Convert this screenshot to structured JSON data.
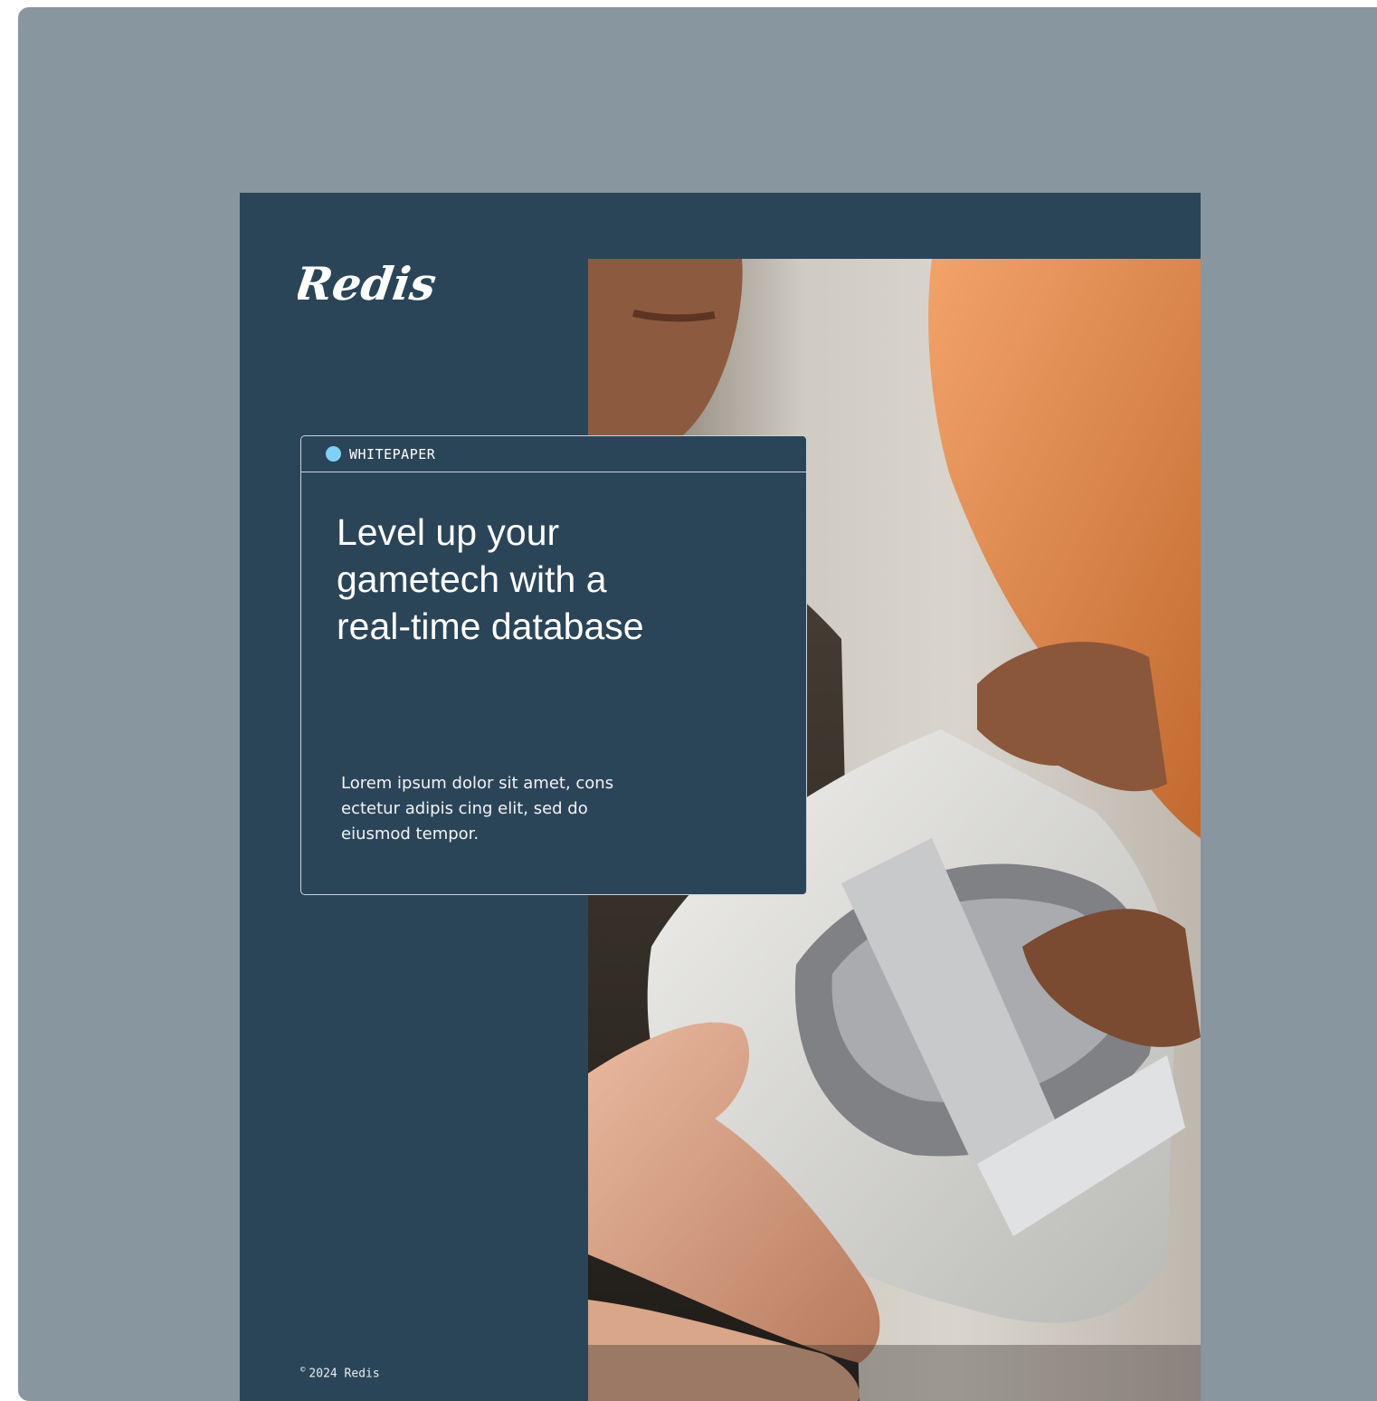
{
  "document": {
    "logo_text": "Redis",
    "tag": "WHITEPAPER",
    "headline_lines": [
      "Level up your",
      "gametech with a",
      "real-time database"
    ],
    "body_lines": [
      "Lorem ipsum dolor sit amet, cons",
      "ectetur adipis cing elit, sed do",
      "eiusmod tempor."
    ],
    "copyright_symbol": "©",
    "copyright_text": "2024 Redis"
  },
  "colors": {
    "frame_background": "#87969f",
    "cover_background": "#2b4558",
    "tag_dot": "#7fd0f5",
    "card_border": "#c9d3da",
    "text": "#ffffff"
  },
  "images": {
    "cover_photo": "hands holding a white VR headset, person in orange shirt in background"
  }
}
